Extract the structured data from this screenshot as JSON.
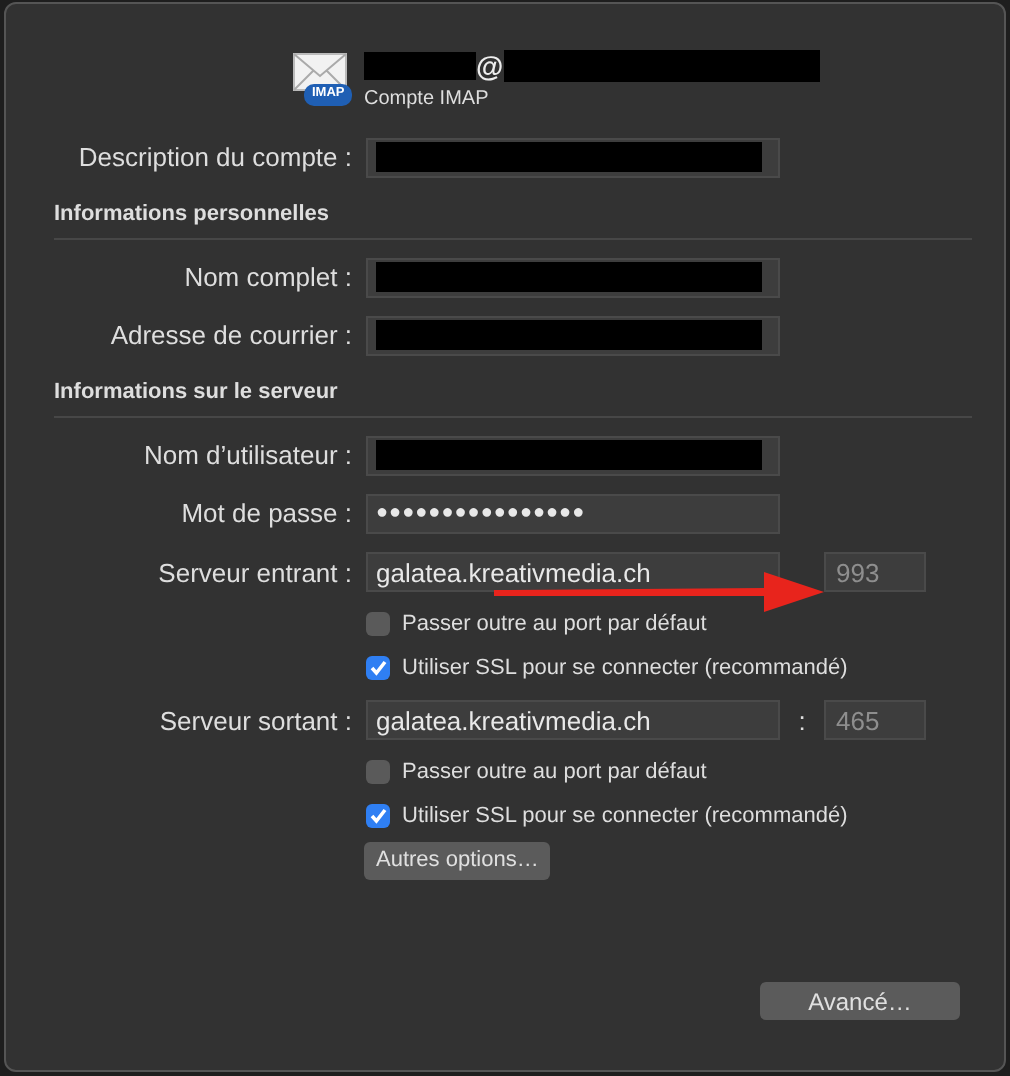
{
  "header": {
    "address_separator": "@",
    "account_type": "Compte IMAP",
    "badge": "IMAP"
  },
  "sections": [
    {
      "rows": [
        {
          "kind": "redacted_field",
          "label": "Description du compte :"
        }
      ]
    },
    {
      "title": "Informations personnelles",
      "rows": [
        {
          "kind": "redacted_field",
          "label": "Nom complet :"
        },
        {
          "kind": "redacted_field",
          "label": "Adresse de courrier :"
        }
      ]
    },
    {
      "title": "Informations sur le serveur",
      "rows": [
        {
          "kind": "redacted_field",
          "label": "Nom d’utilisateur :"
        },
        {
          "kind": "password_field",
          "label": "Mot de passe :",
          "value": "●●●●●●●●●●●●●●●●"
        },
        {
          "kind": "server",
          "label": "Serveur entrant :",
          "value": "galatea.kreativmedia.ch",
          "port": "993",
          "annotated": true
        },
        {
          "kind": "checkbox",
          "label": "Passer outre au port par défaut",
          "checked": false
        },
        {
          "kind": "checkbox",
          "label": "Utiliser SSL pour se connecter (recommandé)",
          "checked": true
        },
        {
          "kind": "server",
          "label": "Serveur sortant :",
          "value": "galatea.kreativmedia.ch",
          "port": "465",
          "separator": ":"
        },
        {
          "kind": "checkbox",
          "label": "Passer outre au port par défaut",
          "checked": false
        },
        {
          "kind": "checkbox",
          "label": "Utiliser SSL pour se connecter (recommandé)",
          "checked": true
        },
        {
          "kind": "button",
          "label": "Autres options…"
        }
      ]
    }
  ],
  "footer_button": "Avancé…"
}
